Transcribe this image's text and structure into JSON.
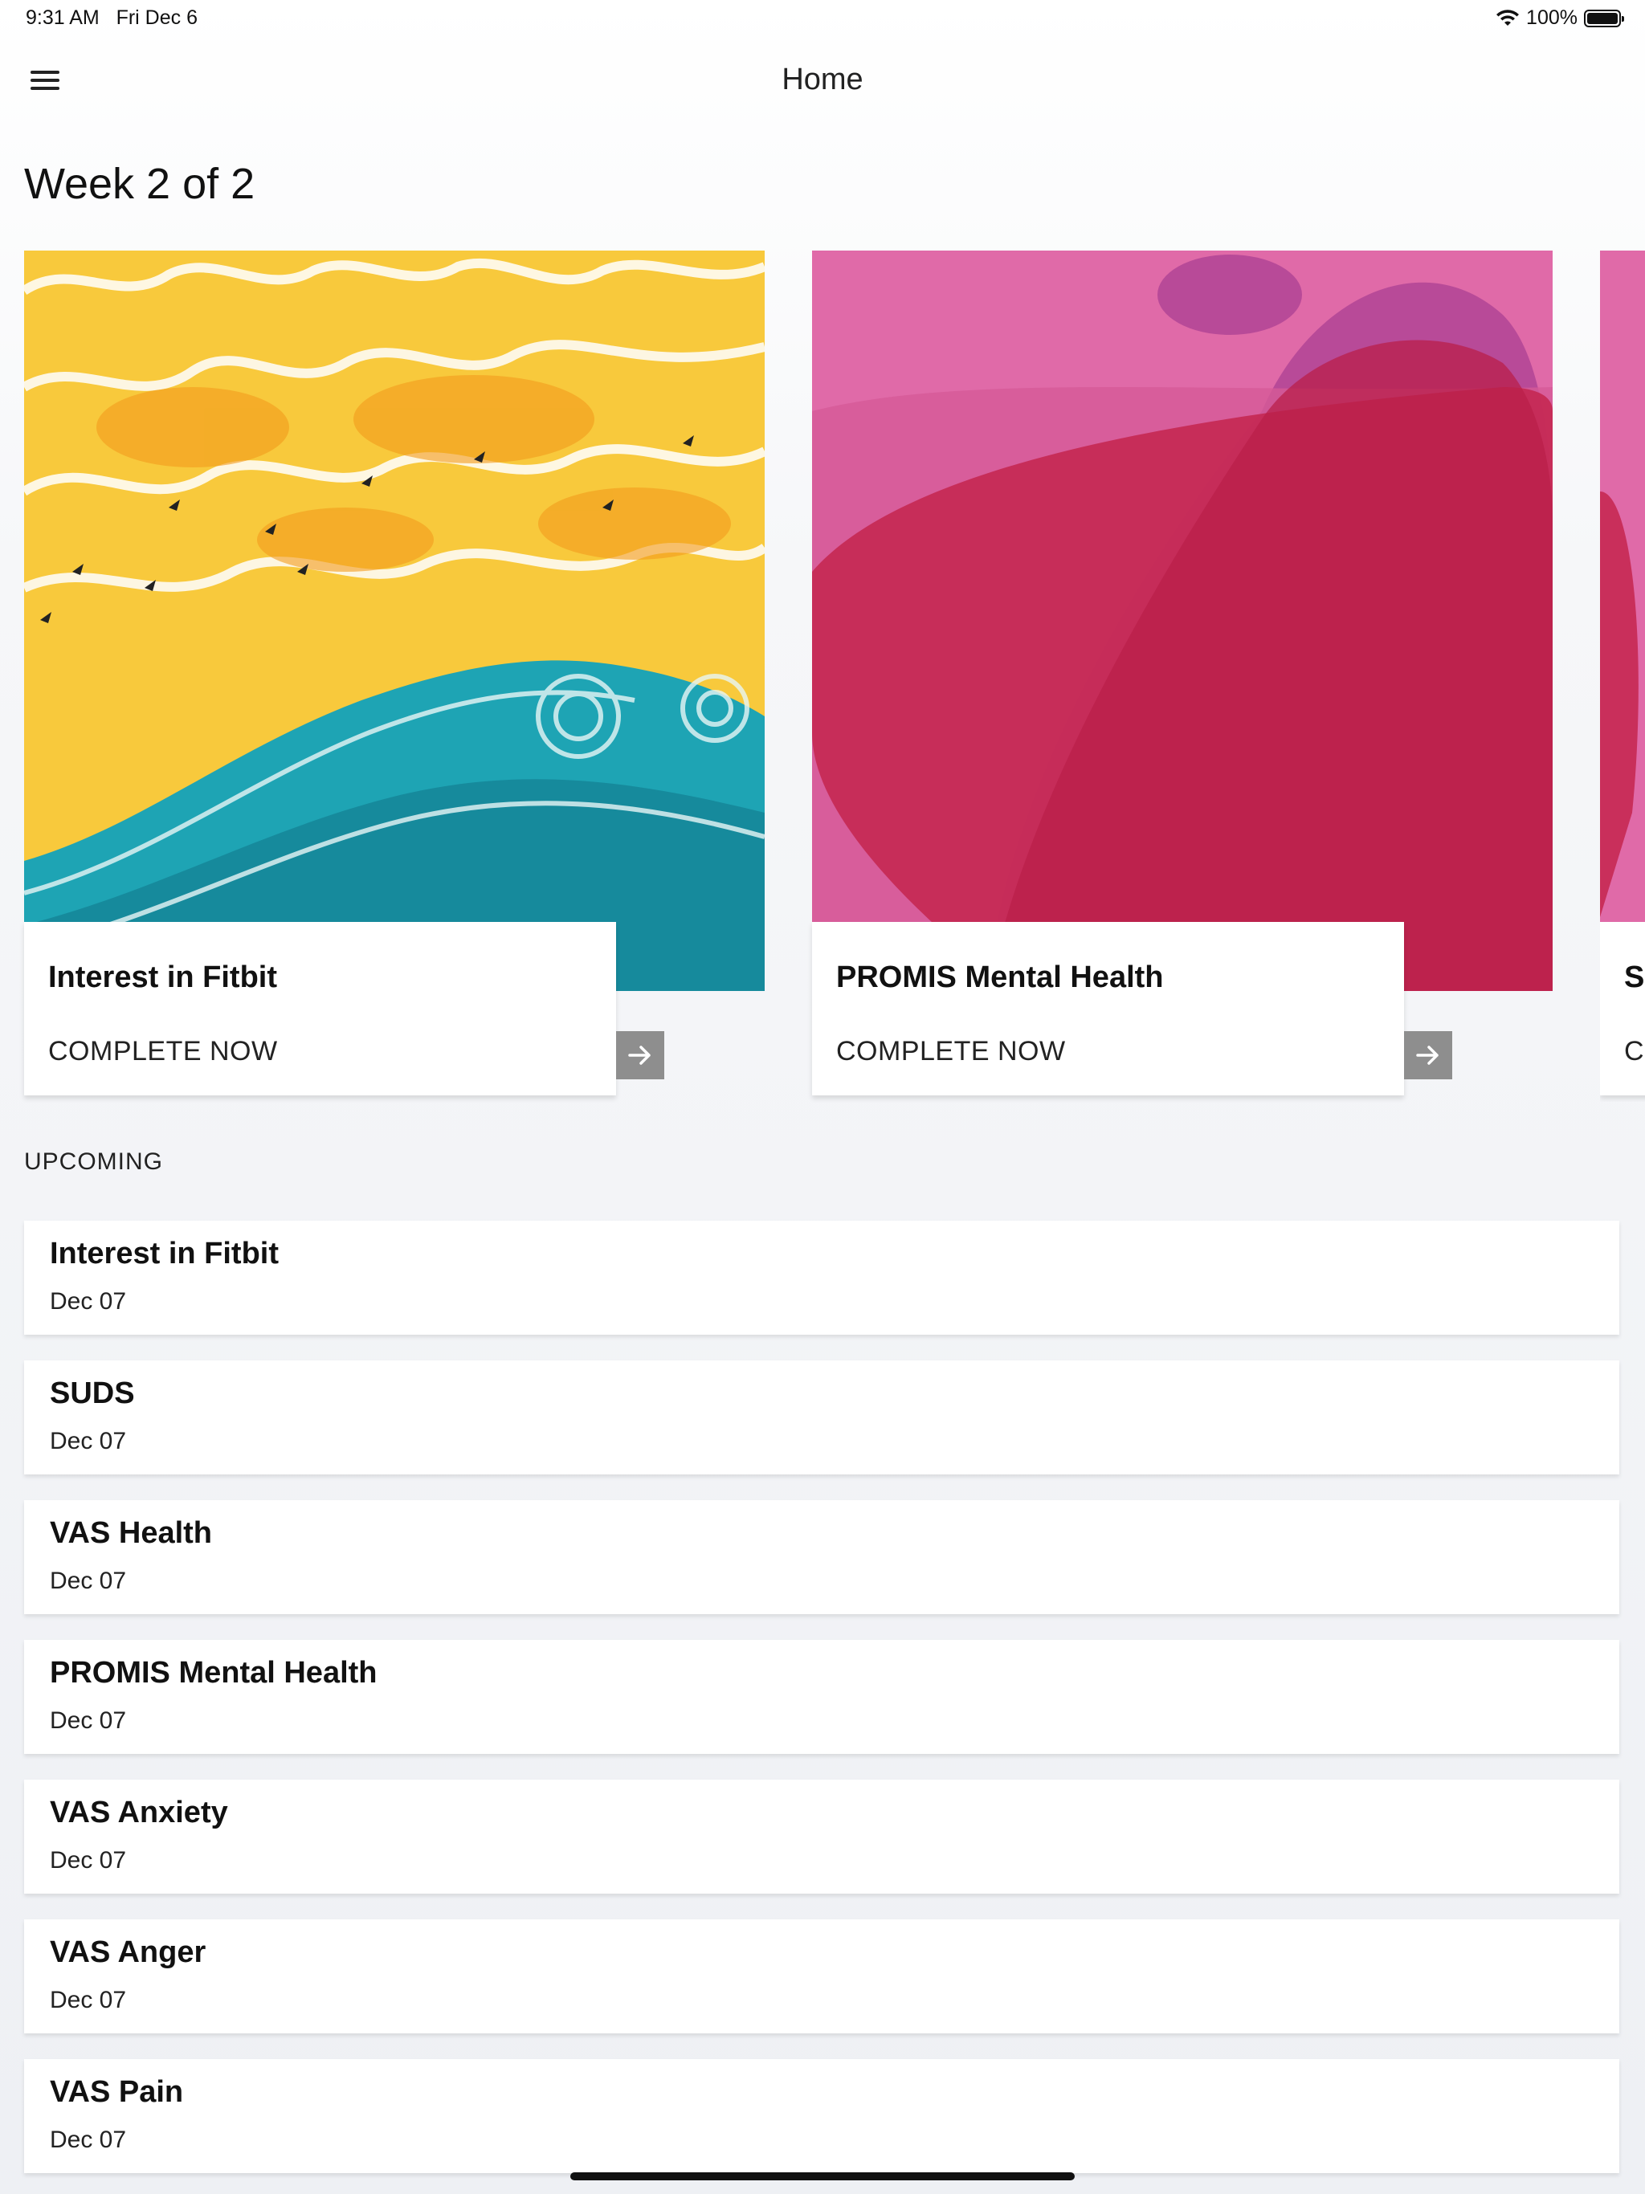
{
  "status_bar": {
    "time": "9:31 AM",
    "date": "Fri Dec 6",
    "battery": "100%"
  },
  "nav": {
    "title": "Home"
  },
  "week_title": "Week 2 of 2",
  "cards": [
    {
      "title": "Interest in Fitbit",
      "action": "COMPLETE NOW"
    },
    {
      "title": "PROMIS Mental Health",
      "action": "COMPLETE NOW"
    },
    {
      "title": "SUDS",
      "action": "COMPLETE NOW"
    }
  ],
  "upcoming": {
    "label": "UPCOMING",
    "items": [
      {
        "title": "Interest in Fitbit",
        "date": "Dec 07"
      },
      {
        "title": "SUDS",
        "date": "Dec 07"
      },
      {
        "title": "VAS Health",
        "date": "Dec 07"
      },
      {
        "title": "PROMIS Mental Health",
        "date": "Dec 07"
      },
      {
        "title": "VAS Anxiety",
        "date": "Dec 07"
      },
      {
        "title": "VAS Anger",
        "date": "Dec 07"
      },
      {
        "title": "VAS Pain",
        "date": "Dec 07"
      }
    ]
  },
  "colors": {
    "arrow_button": "#8e8e8e",
    "pink": "#e06aa8",
    "crimson": "#c4244e",
    "sun": "#f6c63a",
    "sea": "#1ea4b4"
  },
  "icons": {
    "menu": "hamburger-menu-icon",
    "arrow": "arrow-right-icon",
    "wifi": "wifi-icon",
    "battery": "battery-icon"
  }
}
